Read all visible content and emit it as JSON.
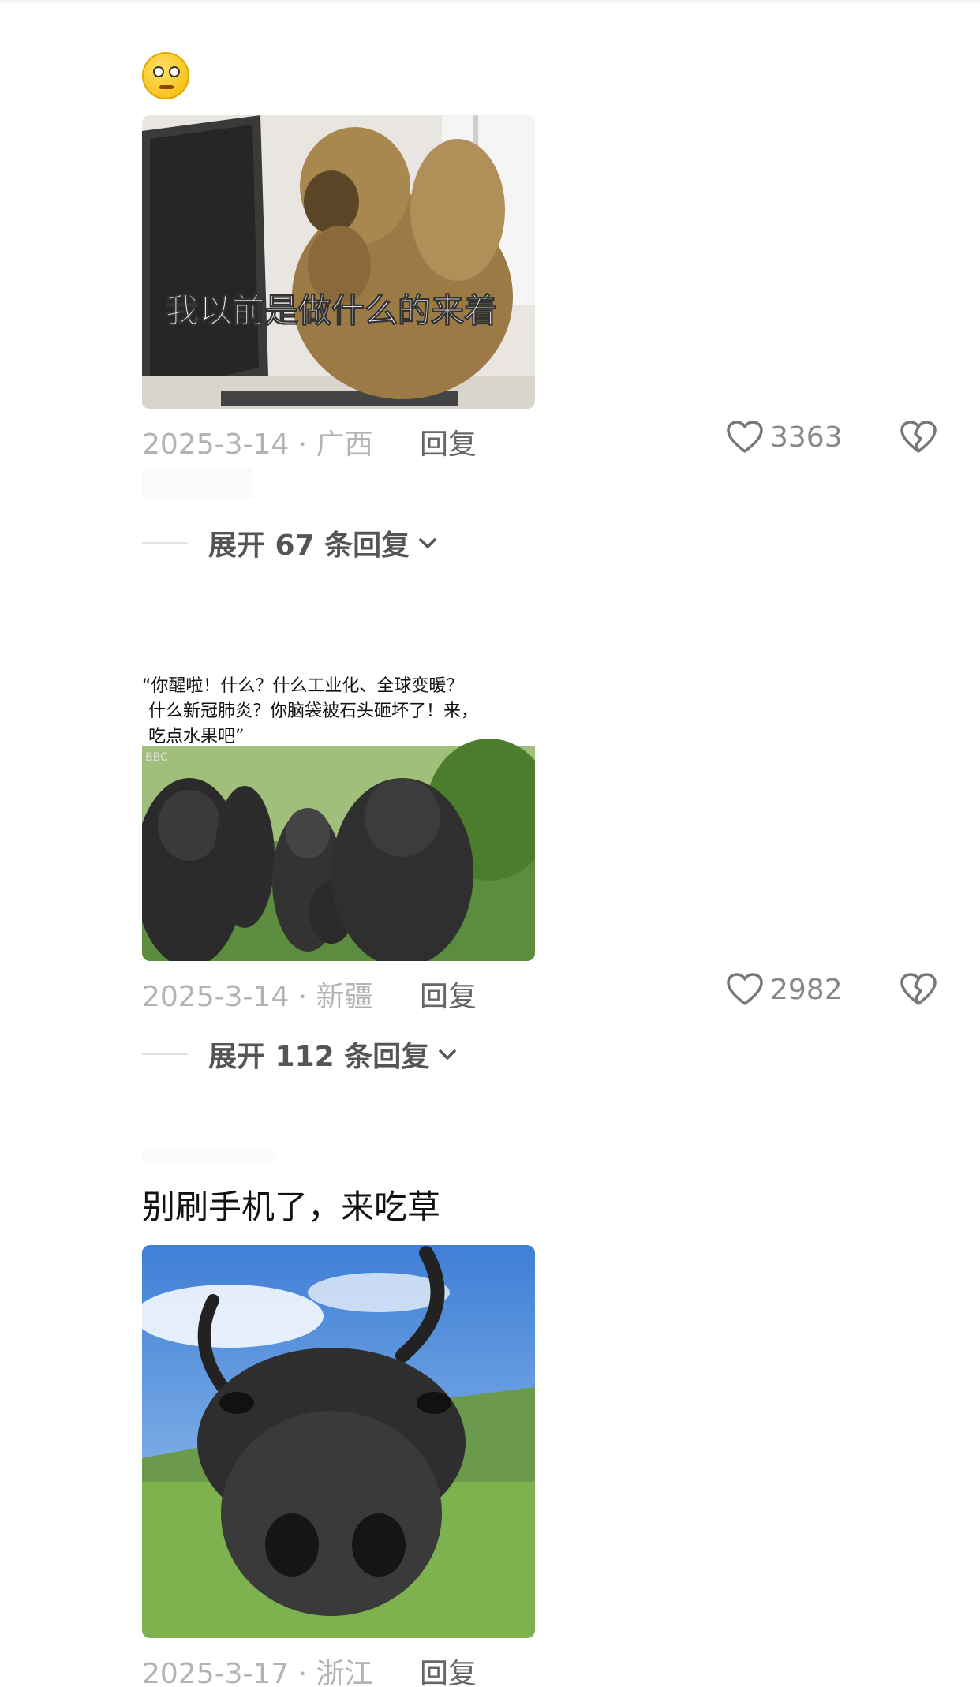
{
  "comments": [
    {
      "meme_caption": "我以前是做什么的来着",
      "date": "2025-3-14 · 广西",
      "reply_label": "回复",
      "likes": "3363",
      "expand_label": "展开 67 条回复"
    },
    {
      "meme_caption": "“你醒啦！什么？什么工业化、全球变暖？\n什么新冠肺炎？你脑袋被石头砸坏了！来，\n吃点水果吧”",
      "image_badge": "BBC",
      "date": "2025-3-14 · 新疆",
      "reply_label": "回复",
      "likes": "2982",
      "expand_label": "展开 112 条回复"
    },
    {
      "text": "别刷手机了，来吃草",
      "date": "2025-3-17 · 浙江",
      "reply_label": "回复"
    }
  ],
  "icons": {
    "like": "heart-outline-icon",
    "dislike": "broken-heart-icon",
    "expand": "chevron-down-icon",
    "emoji": "thinking-face-emoji"
  }
}
